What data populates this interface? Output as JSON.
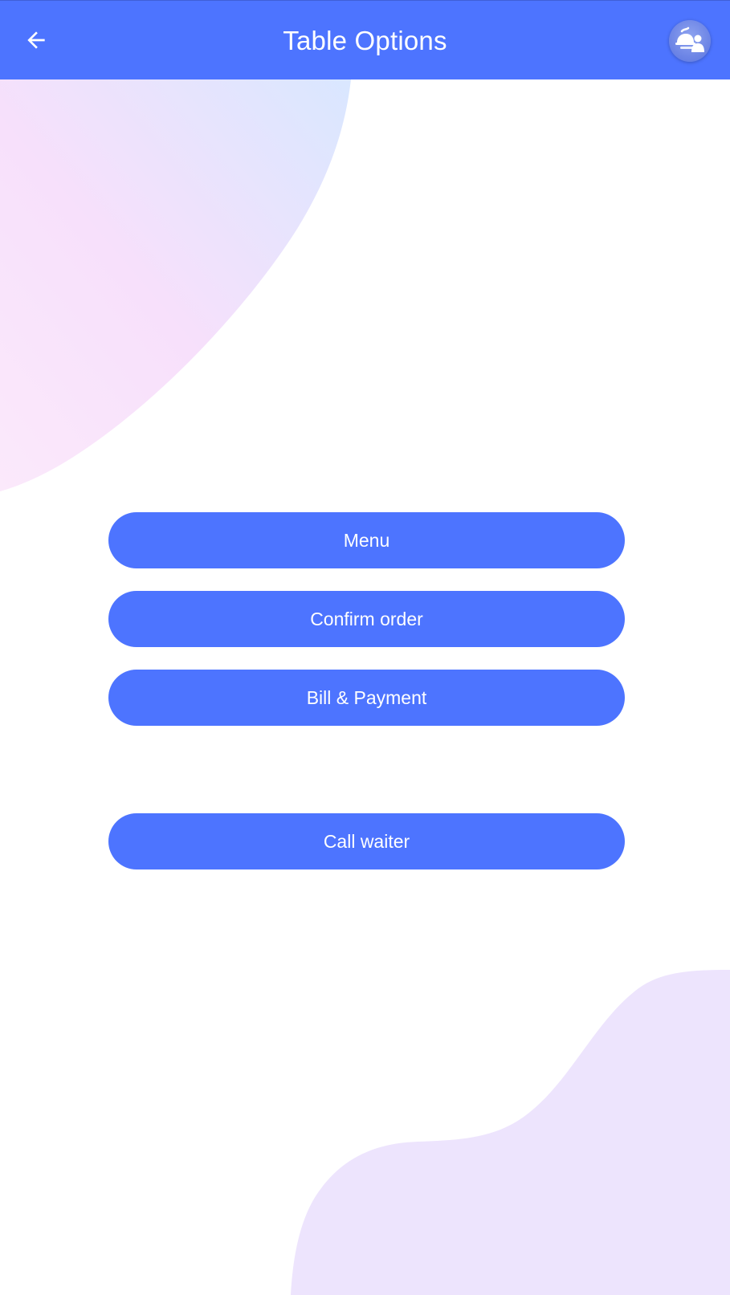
{
  "header": {
    "title": "Table Options",
    "back_icon": "arrow-left-icon",
    "avatar_icon": "waiter-cloche-icon"
  },
  "actions": {
    "menu": "Menu",
    "confirm_order": "Confirm order",
    "bill_payment": "Bill & Payment",
    "call_waiter": "Call waiter"
  },
  "colors": {
    "primary": "#4d74ff",
    "header_text": "#ffffff",
    "top_blob_pink": "#f7e0fb",
    "top_blob_blue": "#d9e7ff",
    "bottom_blob": "#ede4fd"
  }
}
